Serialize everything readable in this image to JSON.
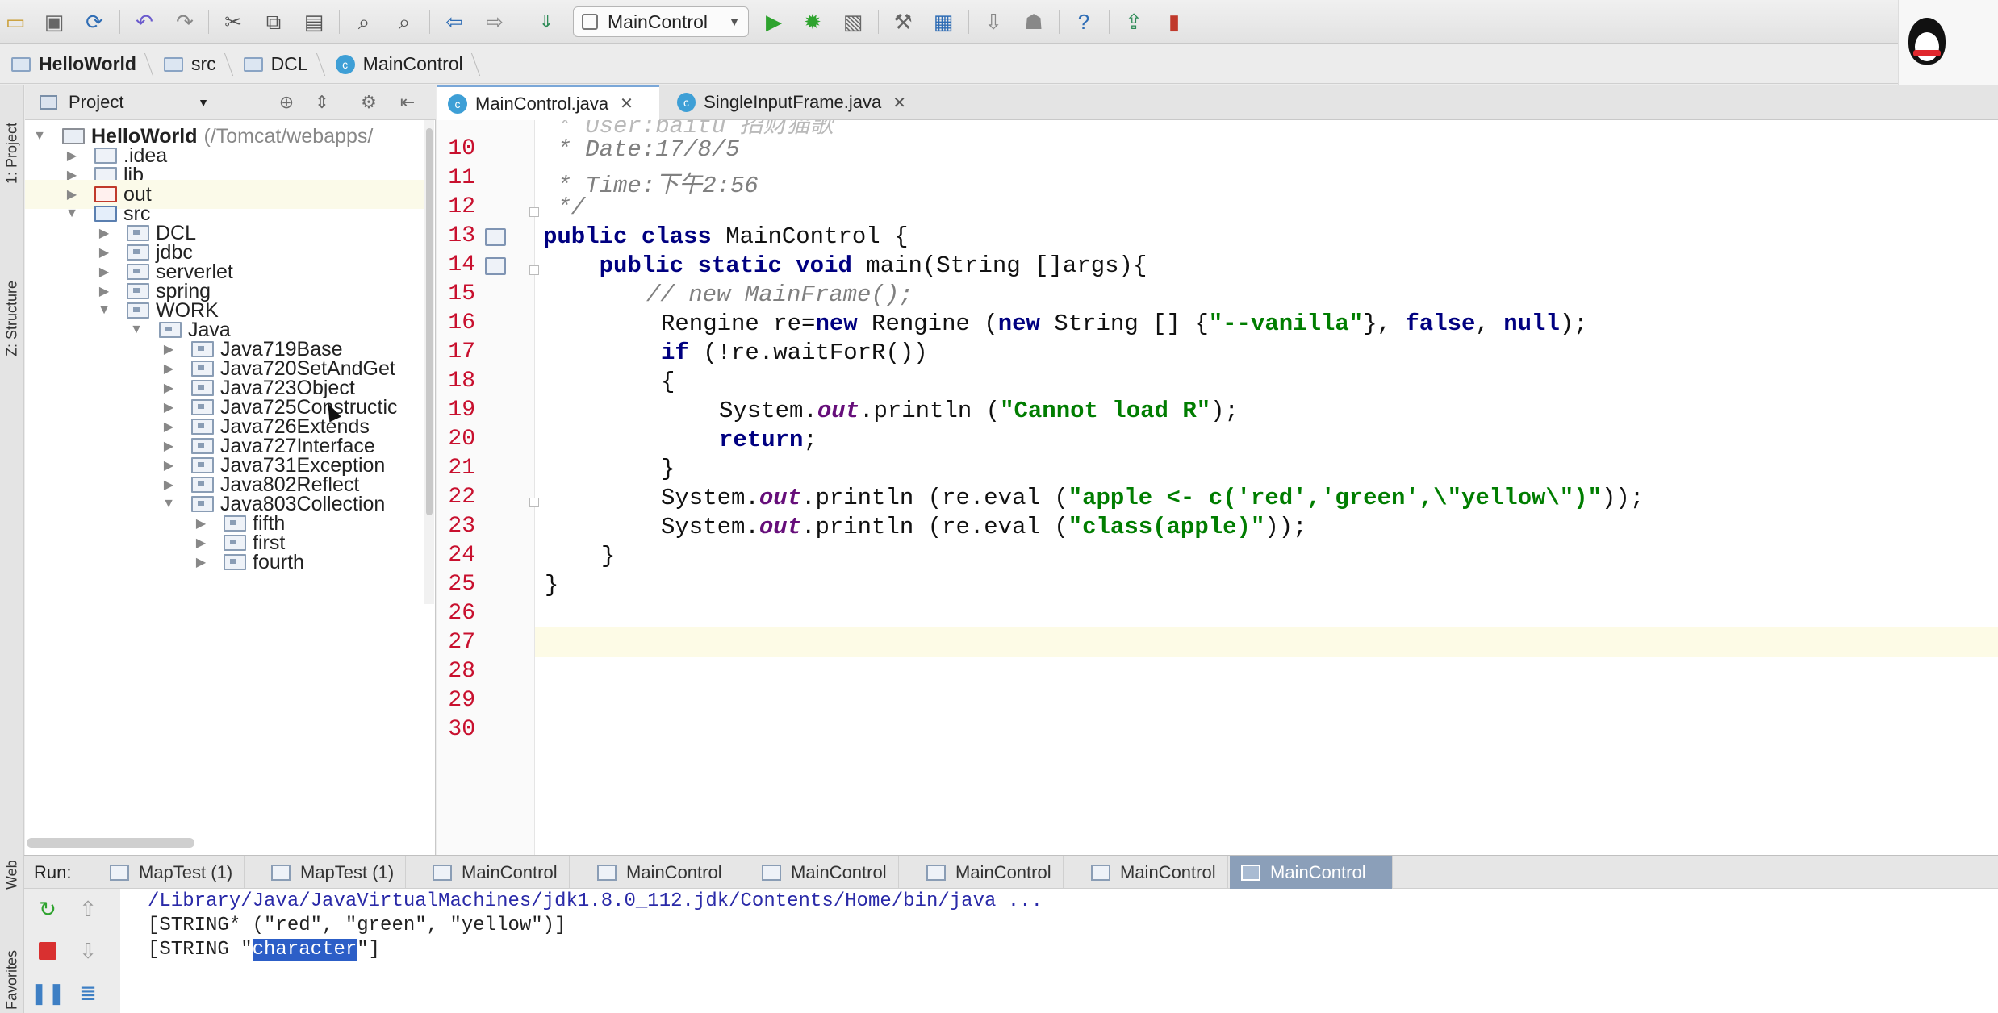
{
  "toolbar": {
    "run_config": "MainControl",
    "colors": {
      "run": "#2ea32e",
      "debug": "#2ea32e",
      "help": "#2f6db5"
    }
  },
  "breadcrumb": [
    "HelloWorld",
    "src",
    "DCL",
    "MainControl"
  ],
  "left_strip": {
    "project": "1: Project",
    "structure": "Z: Structure",
    "web": "Web",
    "favorites": "Favorites"
  },
  "project_panel": {
    "title": "Project",
    "root_name": "HelloWorld",
    "root_path": "(/Tomcat/webapps/",
    "items": [
      {
        "label": ".idea",
        "expanded": false
      },
      {
        "label": "lib",
        "expanded": false
      },
      {
        "label": "out",
        "expanded": false
      },
      {
        "label": "src",
        "expanded": true
      },
      {
        "label": "DCL",
        "expanded": false
      },
      {
        "label": "jdbc",
        "expanded": false
      },
      {
        "label": "serverlet",
        "expanded": false
      },
      {
        "label": "spring",
        "expanded": false
      },
      {
        "label": "WORK",
        "expanded": true
      },
      {
        "label": "Java",
        "expanded": true
      },
      {
        "label": "Java719Base",
        "expanded": false
      },
      {
        "label": "Java720SetAndGet",
        "expanded": false
      },
      {
        "label": "Java723Object",
        "expanded": false
      },
      {
        "label": "Java725Constructic",
        "expanded": false
      },
      {
        "label": "Java726Extends",
        "expanded": false
      },
      {
        "label": "Java727Interface",
        "expanded": false
      },
      {
        "label": "Java731Exception",
        "expanded": false
      },
      {
        "label": "Java802Reflect",
        "expanded": false
      },
      {
        "label": "Java803Collection",
        "expanded": true
      },
      {
        "label": "fifth",
        "expanded": false
      },
      {
        "label": "first",
        "expanded": false
      },
      {
        "label": "fourth",
        "expanded": false
      }
    ]
  },
  "editor_tabs": [
    {
      "label": "MainControl.java",
      "active": true
    },
    {
      "label": "SingleInputFrame.java",
      "active": false
    }
  ],
  "editor": {
    "line_numbers": [
      "10",
      "11",
      "12",
      "13",
      "14",
      "15",
      "16",
      "17",
      "18",
      "19",
      "20",
      "21",
      "22",
      "23",
      "24",
      "25",
      "26",
      "27",
      "28",
      "29",
      "30"
    ],
    "partial_first_line": " * User:baitu 招财猫歌",
    "code": {
      "l10": " * Date:17/8/5",
      "l11": " * Time:下午2:56",
      "l12": " */",
      "l13_kw": "public class",
      "l13_rest": " MainControl {",
      "l14_kw": "public static void",
      "l14_rest": " main(String []args){",
      "l15": "// new MainFrame();",
      "l16_a": "Rengine re=",
      "l16_kw1": "new",
      "l16_b": " Rengine (",
      "l16_kw2": "new",
      "l16_c": " String [] {",
      "l16_str": "\"--vanilla\"",
      "l16_d": "}, ",
      "l16_kw3": "false",
      "l16_e": ", ",
      "l16_kw4": "null",
      "l16_f": ");",
      "l17_kw": "if",
      "l17_rest": " (!re.waitForR())",
      "l18": "{",
      "l19_a": "System.",
      "l19_fld": "out",
      "l19_b": ".println (",
      "l19_str": "\"Cannot load R\"",
      "l19_c": ");",
      "l20_kw": "return",
      "l20_rest": ";",
      "l21": "}",
      "l22_a": "System.",
      "l22_fld": "out",
      "l22_b": ".println (re.eval (",
      "l22_str": "\"apple <- c('red','green',\\\"yellow\\\")\"",
      "l22_c": "));",
      "l23_a": "System.",
      "l23_fld": "out",
      "l23_b": ".println (re.eval (",
      "l23_str": "\"class(apple)\"",
      "l23_c": "));",
      "l24": "}",
      "l25": "}"
    },
    "colors": {
      "keyword": "#000080",
      "string": "#007d00",
      "comment": "#808080",
      "line_number": "#c8102e",
      "current_line": "#fdfbe6"
    }
  },
  "run_panel": {
    "label": "Run:",
    "tabs": [
      "MapTest (1)",
      "MapTest (1)",
      "MainControl",
      "MainControl",
      "MainControl",
      "MainControl",
      "MainControl",
      "MainControl"
    ],
    "console": {
      "line1": "/Library/Java/JavaVirtualMachines/jdk1.8.0_112.jdk/Contents/Home/bin/java ...",
      "line2": "[STRING* (\"red\", \"green\", \"yellow\")]",
      "line3_pre": "[STRING \"",
      "line3_sel": "character",
      "line3_post": "\"]"
    },
    "colors": {
      "path": "#2a2aa8",
      "selection": "#2c5ec7"
    }
  }
}
